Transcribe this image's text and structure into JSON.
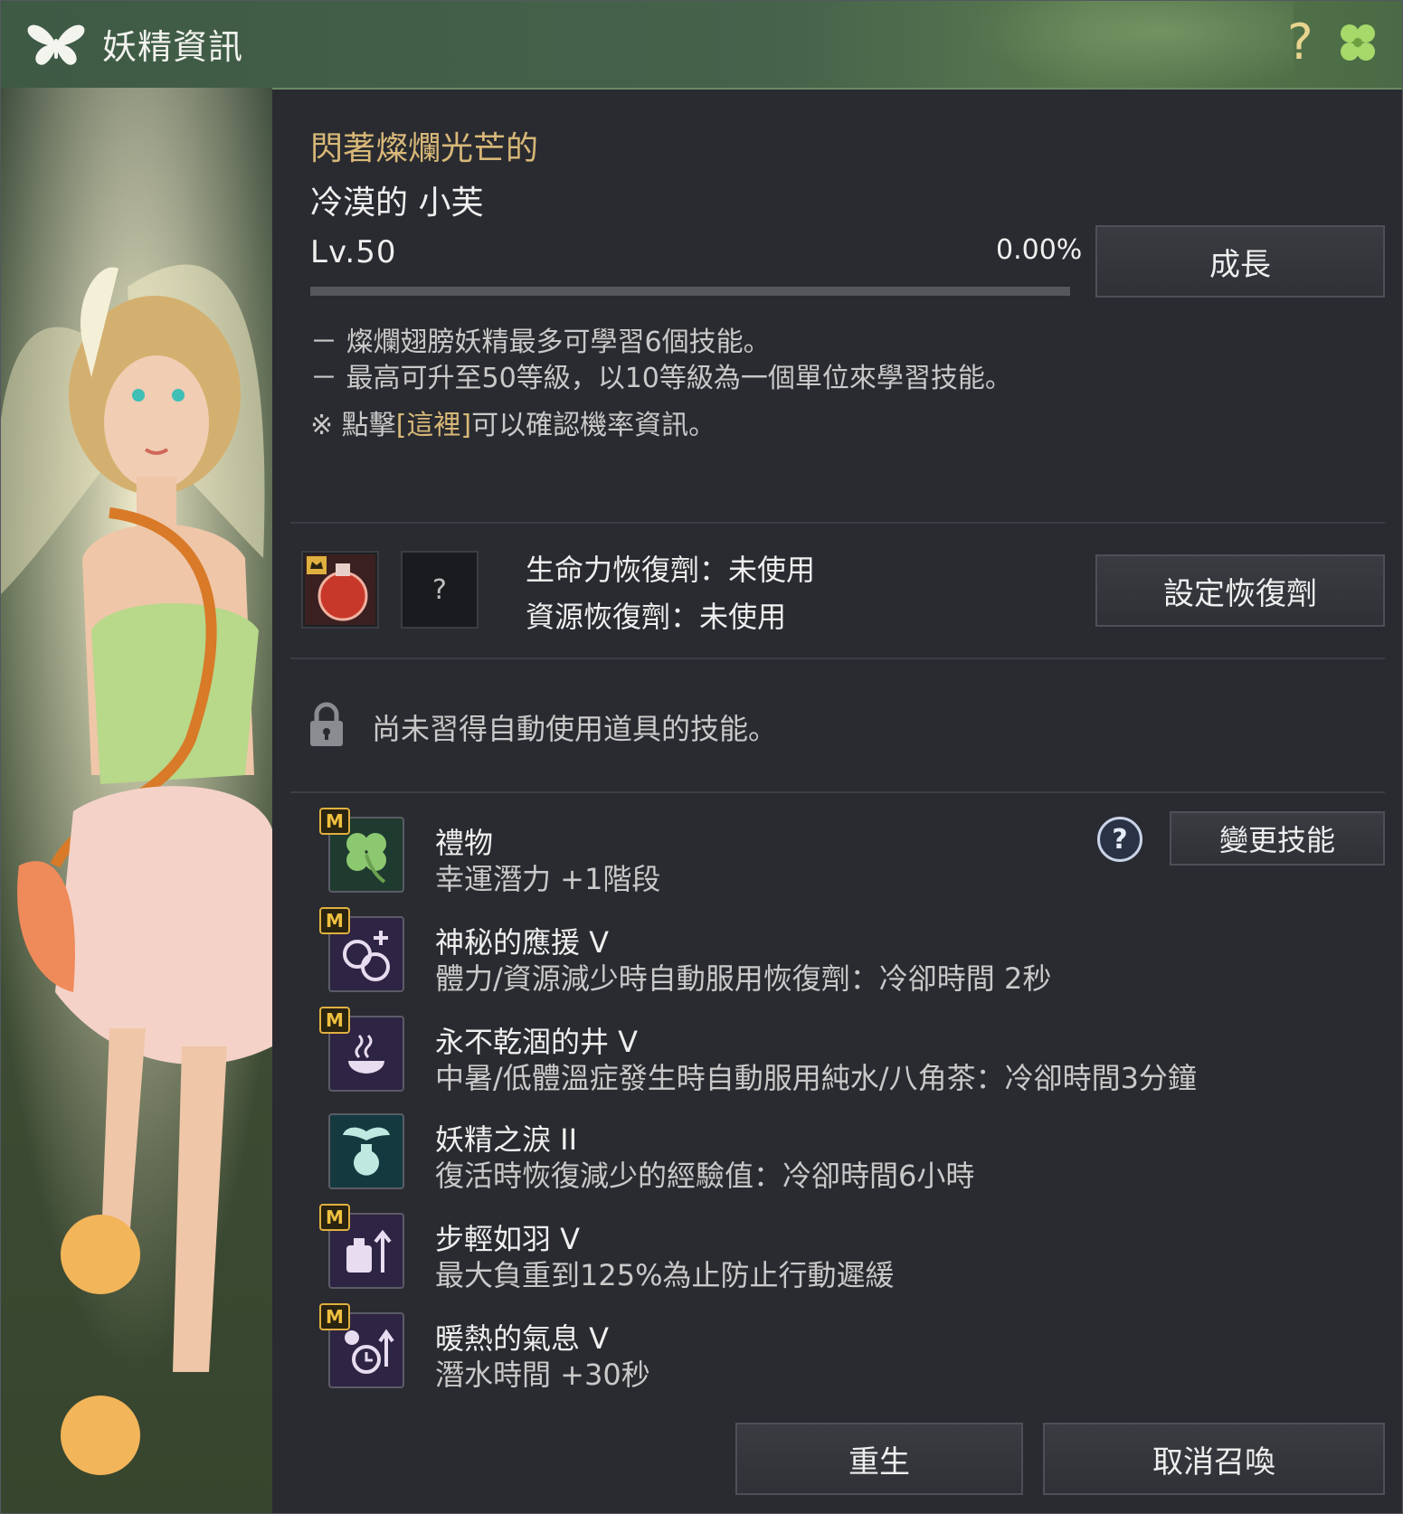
{
  "window": {
    "title": "妖精資訊",
    "icons": {
      "title": "butterfly-icon",
      "help": "question-mark-icon",
      "extra": "clover-icon"
    },
    "help_glyph": "?"
  },
  "fairy": {
    "subtitle": "閃著燦爛光芒的",
    "name": "冷漠的 小芙",
    "level": "Lv.50",
    "exp": "0.00%",
    "exp_fraction": 0.0,
    "grow_label": "成長"
  },
  "info": {
    "line1": "－ 燦爛翅膀妖精最多可學習6個技能。",
    "line2": "－ 最高可升至50等級，以10等級為一個單位來學習技能。",
    "line3_prefix": "※ 點擊",
    "line3_link": "[這裡]",
    "line3_suffix": "可以確認機率資訊。"
  },
  "potion": {
    "hp_status": "生命力恢復劑：未使用",
    "res_status": "資源恢復劑：未使用",
    "res_slot_glyph": "?",
    "set_label": "設定恢復劑"
  },
  "auto_item": {
    "locked_message": "尚未習得自動使用道具的技能。"
  },
  "skills": {
    "help_glyph": "?",
    "change_label": "變更技能",
    "badge": "M",
    "items": [
      {
        "name": "禮物",
        "desc": "幸運潛力 +1階段",
        "icon": "clover-icon"
      },
      {
        "name": "神秘的應援 V",
        "desc": "體力/資源減少時自動服用恢復劑：冷卻時間 2秒",
        "icon": "potion-icon"
      },
      {
        "name": "永不乾涸的井 V",
        "desc": "中暑/低體溫症發生時自動服用純水/八角茶：冷卻時間3分鐘",
        "icon": "steaming-bowl-icon"
      },
      {
        "name": "妖精之淚 II",
        "desc": "復活時恢復減少的經驗值：冷卻時間6小時",
        "icon": "winged-vial-icon"
      },
      {
        "name": "步輕如羽 V",
        "desc": "最大負重到125%為止防止行動遲緩",
        "icon": "weight-arrow-icon"
      },
      {
        "name": "暖熱的氣息 V",
        "desc": "潛水時間 +30秒",
        "icon": "bubble-timer-icon"
      }
    ]
  },
  "footer": {
    "rebirth_label": "重生",
    "unsummon_label": "取消召喚"
  },
  "colors": {
    "title_bar": "#45624b",
    "panel": "#2a2b30",
    "gold": "#d8b878",
    "badge": "#f0c040"
  }
}
